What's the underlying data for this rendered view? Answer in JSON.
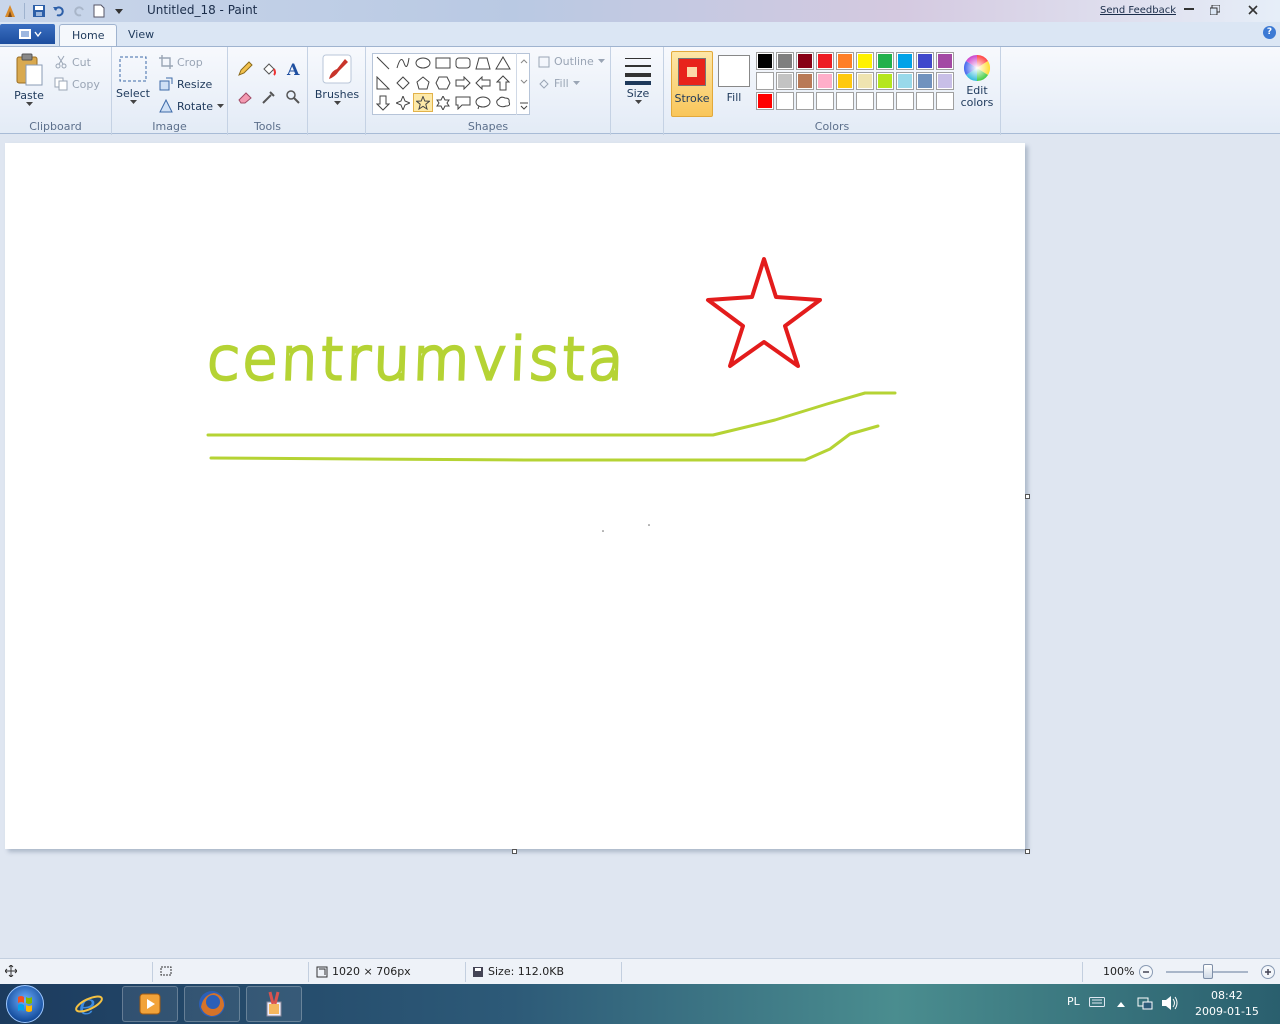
{
  "window": {
    "title": "Untitled_18 - Paint",
    "send_feedback": "Send Feedback"
  },
  "tabs": [
    {
      "label": "Home",
      "active": true
    },
    {
      "label": "View",
      "active": false
    }
  ],
  "ribbon": {
    "clipboard": {
      "label": "Clipboard",
      "paste": "Paste",
      "cut": "Cut",
      "copy": "Copy"
    },
    "image": {
      "label": "Image",
      "select": "Select",
      "crop": "Crop",
      "resize": "Resize",
      "rotate": "Rotate"
    },
    "tools": {
      "label": "Tools"
    },
    "brushes": {
      "label": "Brushes"
    },
    "shapes": {
      "label": "Shapes",
      "outline": "Outline",
      "fill": "Fill"
    },
    "size": {
      "label": "Size"
    },
    "colors": {
      "label": "Colors",
      "stroke": "Stroke",
      "fill": "Fill",
      "edit_colors_1": "Edit",
      "edit_colors_2": "colors",
      "stroke_color": "#e8231b",
      "fill_color": "#ffffff",
      "palette": [
        "#000000",
        "#7f7f7f",
        "#880015",
        "#ed1c24",
        "#ff7f27",
        "#fff200",
        "#22b14c",
        "#00a2e8",
        "#3f48cc",
        "#a349a4",
        "#ffffff",
        "#c3c3c3",
        "#b97a57",
        "#ffaec9",
        "#ffc90e",
        "#efe4b0",
        "#b5e61d",
        "#99d9ea",
        "#7092be",
        "#c8bfe7",
        "#ff0000",
        "#ffffff",
        "#ffffff",
        "#ffffff",
        "#ffffff",
        "#ffffff",
        "#ffffff",
        "#ffffff",
        "#ffffff",
        "#ffffff"
      ]
    }
  },
  "canvas": {
    "drawn_text": "centrumvista",
    "text_color": "#b5d334",
    "star_color": "#e31c1c"
  },
  "status": {
    "dimensions": "1020 × 706px",
    "size": "Size: 112.0KB",
    "zoom": "100%"
  },
  "taskbar": {
    "language": "PL",
    "time": "08:42",
    "date": "2009-01-15"
  }
}
